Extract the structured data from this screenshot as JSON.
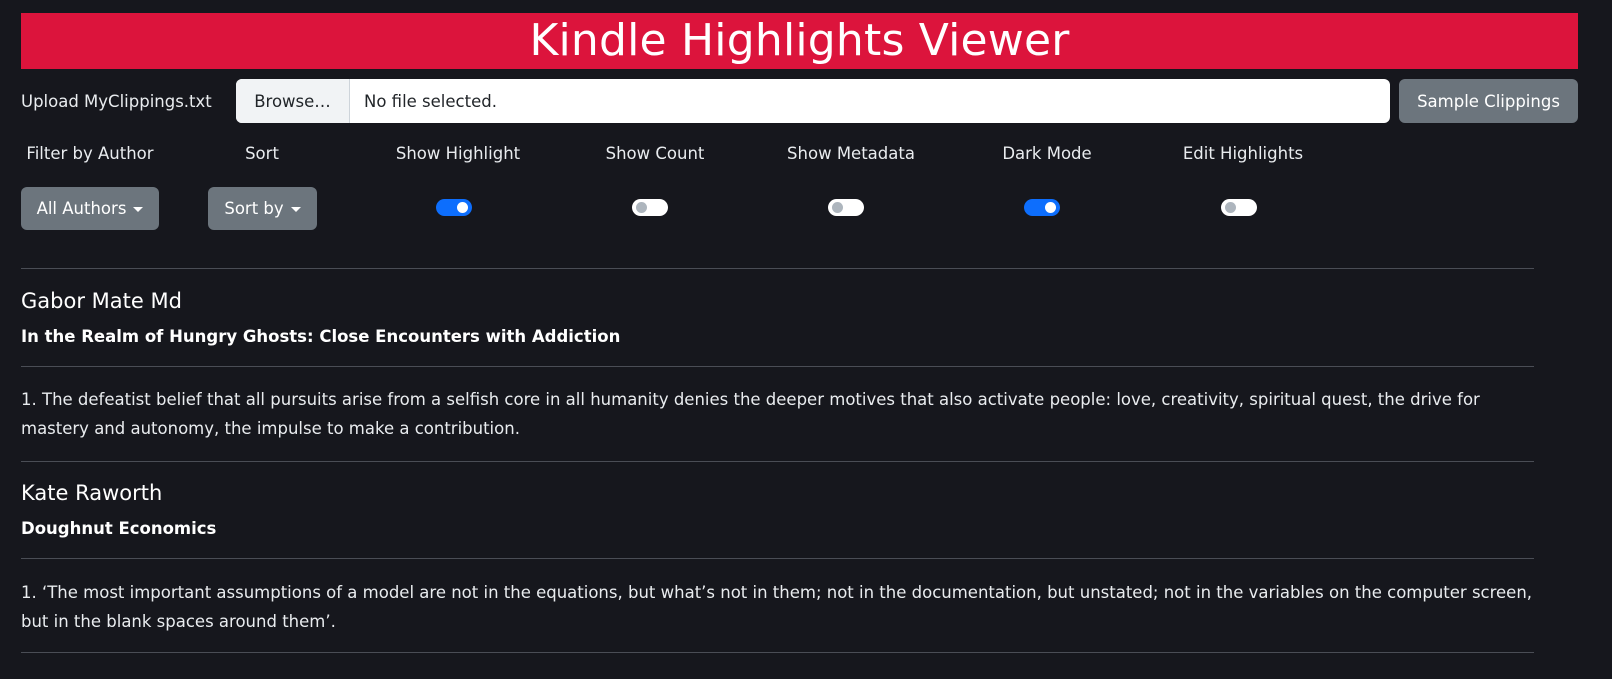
{
  "header": {
    "title": "Kindle Highlights Viewer"
  },
  "upload": {
    "label": "Upload MyClippings.txt",
    "browse_label": "Browse…",
    "file_status": "No file selected.",
    "sample_button": "Sample Clippings"
  },
  "controls": {
    "filter_label": "Filter by Author",
    "filter_value": "All Authors",
    "sort_label": "Sort",
    "sort_value": "Sort by",
    "toggles": [
      {
        "label": "Show Highlight",
        "on": true
      },
      {
        "label": "Show Count",
        "on": false
      },
      {
        "label": "Show Metadata",
        "on": false
      },
      {
        "label": "Dark Mode",
        "on": true
      },
      {
        "label": "Edit Highlights",
        "on": false
      }
    ]
  },
  "books": [
    {
      "author": "Gabor Mate Md",
      "title": "In the Realm of Hungry Ghosts: Close Encounters with Addiction",
      "highlights": [
        "1. The defeatist belief that all pursuits arise from a selfish core in all humanity denies the deeper motives that also activate people: love, creativity, spiritual quest, the drive for mastery and autonomy, the impulse to make a contribution."
      ]
    },
    {
      "author": "Kate Raworth",
      "title": "Doughnut Economics",
      "highlights": [
        "1. ‘The most important assumptions of a model are not in the equations, but what’s not in them; not in the documentation, but unstated; not in the variables on the computer screen, but in the blank spaces around them’."
      ]
    }
  ]
}
